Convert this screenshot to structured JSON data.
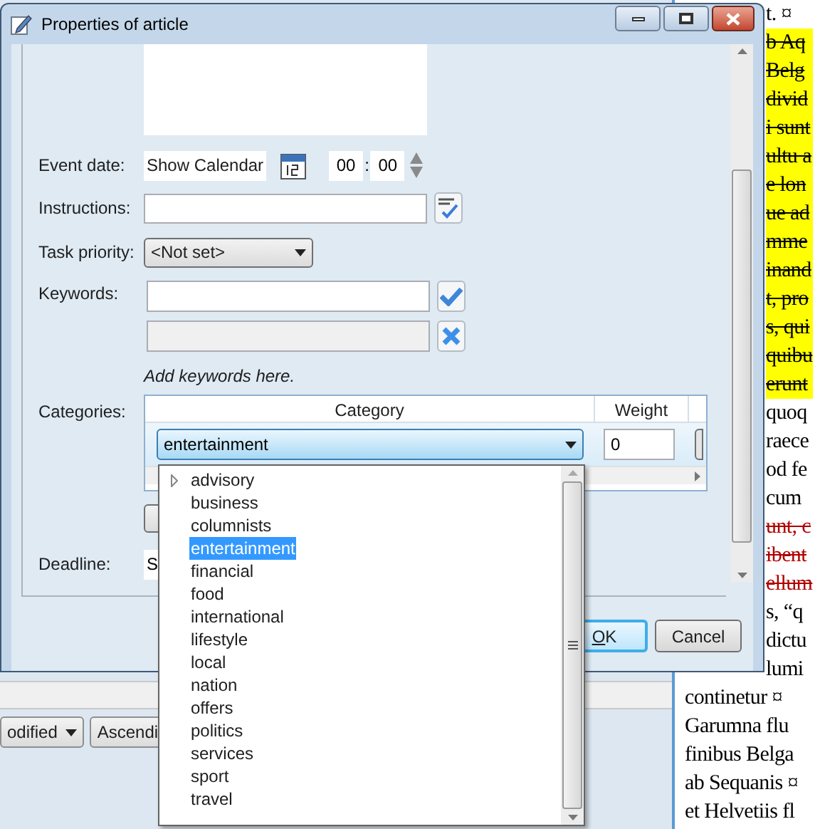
{
  "dialog": {
    "title": "Properties of article",
    "form": {
      "event_date": {
        "label": "Event date:",
        "button": "Show Calendar",
        "hour": "00",
        "separator": ":",
        "minute": "00"
      },
      "instructions": {
        "label": "Instructions:"
      },
      "task_priority": {
        "label": "Task priority:",
        "value": "<Not set>"
      },
      "keywords": {
        "label": "Keywords:",
        "hint": "Add keywords here.",
        "second_field_disabled": true
      },
      "categories": {
        "label": "Categories:",
        "columns": [
          "Category",
          "Weight"
        ],
        "rows": [
          {
            "category": "entertainment",
            "weight": "0"
          }
        ]
      },
      "deadline": {
        "label": "Deadline:",
        "value": "S"
      }
    },
    "buttons": [
      {
        "label": "OK",
        "default": true
      },
      {
        "label": "Cancel",
        "default": false
      }
    ]
  },
  "category_dropdown": {
    "items": [
      {
        "label": "advisory",
        "selected": false,
        "expandable": true
      },
      {
        "label": "business",
        "selected": false,
        "expandable": false
      },
      {
        "label": "columnists",
        "selected": false,
        "expandable": false
      },
      {
        "label": "entertainment",
        "selected": true,
        "expandable": false
      },
      {
        "label": "financial",
        "selected": false,
        "expandable": false
      },
      {
        "label": "food",
        "selected": false,
        "expandable": false
      },
      {
        "label": "international",
        "selected": false,
        "expandable": false
      },
      {
        "label": "lifestyle",
        "selected": false,
        "expandable": false
      },
      {
        "label": "local",
        "selected": false,
        "expandable": false
      },
      {
        "label": "nation",
        "selected": false,
        "expandable": false
      },
      {
        "label": "offers",
        "selected": false,
        "expandable": false
      },
      {
        "label": "politics",
        "selected": false,
        "expandable": false
      },
      {
        "label": "services",
        "selected": false,
        "expandable": false
      },
      {
        "label": "sport",
        "selected": false,
        "expandable": false
      },
      {
        "label": "travel",
        "selected": false,
        "expandable": false
      }
    ]
  },
  "background": {
    "toolbar": [
      {
        "label": "odified",
        "dropdown": true
      },
      {
        "label": "Ascendi",
        "dropdown": false
      }
    ]
  },
  "document": {
    "upper_lines": [
      {
        "text": "t. ¤",
        "kind": "normal"
      },
      {
        "text": "b Aq",
        "kind": "highlight"
      },
      {
        "text": "Belg",
        "kind": "highlight"
      },
      {
        "text": "divid",
        "kind": "highlight"
      },
      {
        "text": "i sunt",
        "kind": "highlight"
      },
      {
        "text": "ultu a",
        "kind": "highlight"
      },
      {
        "text": "e lon",
        "kind": "highlight"
      },
      {
        "text": "ue ad",
        "kind": "highlight"
      },
      {
        "text": "mme",
        "kind": "highlight"
      },
      {
        "text": "inand",
        "kind": "highlight"
      },
      {
        "text": "t, pro",
        "kind": "highlight"
      },
      {
        "text": "s, qui",
        "kind": "highlight"
      },
      {
        "text": "quibu",
        "kind": "highlight"
      },
      {
        "text": "erunt",
        "kind": "highlight"
      },
      {
        "text": "quoq",
        "kind": "normal"
      },
      {
        "text": "raece",
        "kind": "normal"
      },
      {
        "text": "od fe",
        "kind": "normal"
      },
      {
        "text": "cum",
        "kind": "normal"
      },
      {
        "text": "unt, c",
        "kind": "deleted"
      },
      {
        "text": "ibent",
        "kind": "deleted"
      },
      {
        "text": "ellum",
        "kind": "deleted"
      },
      {
        "text": "s, “q",
        "kind": "normal"
      },
      {
        "text": "dictu",
        "kind": "normal"
      },
      {
        "text": "lumi",
        "kind": "normal"
      }
    ],
    "lower_lines": [
      {
        "text": "continetur ¤",
        "kind": "normal"
      },
      {
        "text": "Garumna flu",
        "kind": "normal"
      },
      {
        "text": "finibus Belga",
        "kind": "normal"
      },
      {
        "text": "ab Sequanis ¤",
        "kind": "normal"
      },
      {
        "text": "et Helvetiis fl",
        "kind": "normal"
      }
    ]
  }
}
